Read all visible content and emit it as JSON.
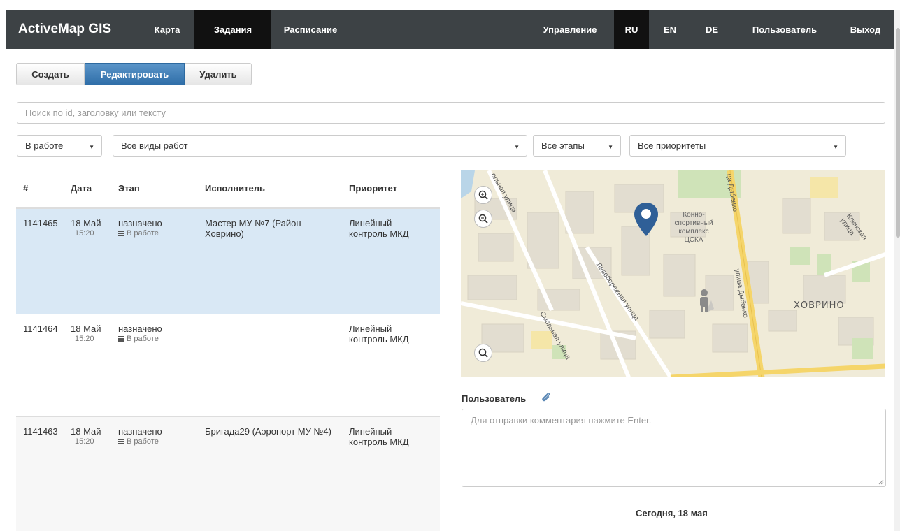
{
  "navbar": {
    "brand": "ActiveMap GIS",
    "left_items": [
      {
        "label": "Карта",
        "active": false
      },
      {
        "label": "Задания",
        "active": true
      },
      {
        "label": "Расписание",
        "active": false
      }
    ],
    "right_items": [
      {
        "label": "Управление",
        "active": false
      },
      {
        "label": "RU",
        "active": true
      },
      {
        "label": "EN",
        "active": false
      },
      {
        "label": "DE",
        "active": false
      },
      {
        "label": "Пользователь",
        "active": false
      },
      {
        "label": "Выход",
        "active": false
      }
    ]
  },
  "toolbar": {
    "create_label": "Создать",
    "edit_label": "Редактировать",
    "delete_label": "Удалить"
  },
  "search": {
    "placeholder": "Поиск по id, заголовку или тексту"
  },
  "filters": {
    "status": "В работе",
    "work_type": "Все виды работ",
    "stage": "Все этапы",
    "priority": "Все приоритеты"
  },
  "table": {
    "headers": {
      "id": "#",
      "date": "Дата",
      "stage": "Этап",
      "executor": "Исполнитель",
      "priority": "Приоритет"
    },
    "rows": [
      {
        "id": "1141465",
        "date": "18 Май",
        "time": "15:20",
        "stage": "назначено",
        "status": "В работе",
        "executor": "Мастер МУ №7 (Район Ховрино)",
        "priority": "Линейный контроль МКД",
        "selected": true
      },
      {
        "id": "1141464",
        "date": "18 Май",
        "time": "15:20",
        "stage": "назначено",
        "status": "В работе",
        "executor": "",
        "priority": "Линейный контроль МКД",
        "selected": false
      },
      {
        "id": "1141463",
        "date": "18 Май",
        "time": "15:20",
        "stage": "назначено",
        "status": "В работе",
        "executor": "Бригада29 (Аэропорт МУ №4)",
        "priority": "Линейный контроль МКД",
        "selected": false
      }
    ]
  },
  "map": {
    "labels": {
      "area": "ХОВРИНО",
      "complex": [
        "Конно-",
        "спортивный",
        "комплекс",
        "ЦСКА"
      ],
      "street1": "Смольная улица",
      "street2": "Левобережная улица",
      "street3": "улица Дыбенко",
      "street4": "Клинская улица",
      "street5": "ца Дыбенко",
      "street6": "ольная улица"
    }
  },
  "comments": {
    "user_label": "Пользователь",
    "placeholder": "Для отправки комментария нажмите Enter.",
    "date_header": "Сегодня, 18 мая"
  },
  "colors": {
    "navbar": "#3d4245",
    "primary": "#337ab7",
    "selected_row": "#d9e8f5",
    "marker": "#2f5f97"
  }
}
